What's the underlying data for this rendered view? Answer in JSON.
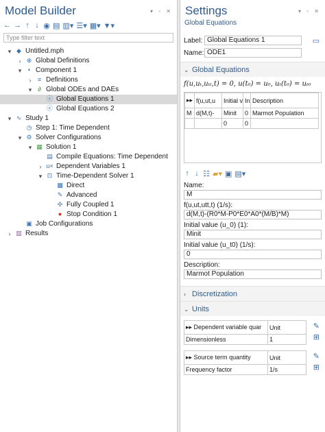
{
  "left": {
    "title": "Model Builder",
    "window_controls": "▾ ▫ ✕",
    "filter_placeholder": "Type filter text",
    "tree": [
      {
        "label": "Untitled.mph",
        "icon": "model-icon",
        "glyph": "◆",
        "color": "#3a74b8",
        "depth": 0,
        "arrow": "▾"
      },
      {
        "label": "Global Definitions",
        "icon": "globe-icon",
        "glyph": "⊕",
        "color": "#3a74b8",
        "depth": 1,
        "arrow": "›"
      },
      {
        "label": "Component 1",
        "icon": "component-icon",
        "glyph": "•",
        "color": "#3a74b8",
        "depth": 1,
        "arrow": "▾"
      },
      {
        "label": "Definitions",
        "icon": "definitions-icon",
        "glyph": "≡",
        "color": "#3a74b8",
        "depth": 2,
        "arrow": "›"
      },
      {
        "label": "Global ODEs and DAEs",
        "icon": "ode-icon",
        "glyph": "∂",
        "color": "#4a7a3a",
        "depth": 2,
        "arrow": "▾"
      },
      {
        "label": "Global Equations 1",
        "icon": "global-equations-icon",
        "glyph": "ⓔ",
        "color": "#3a74b8",
        "depth": 3,
        "arrow": "",
        "selected": true
      },
      {
        "label": "Global Equations 2",
        "icon": "global-equations-icon",
        "glyph": "ⓔ",
        "color": "#3a74b8",
        "depth": 3,
        "arrow": ""
      },
      {
        "label": "Study 1",
        "icon": "study-icon",
        "glyph": "∿",
        "color": "#3a74b8",
        "depth": 0,
        "arrow": "▾"
      },
      {
        "label": "Step 1: Time Dependent",
        "icon": "time-step-icon",
        "glyph": "◷",
        "color": "#3a74b8",
        "depth": 1,
        "arrow": ""
      },
      {
        "label": "Solver Configurations",
        "icon": "solver-configurations-icon",
        "glyph": "⚙",
        "color": "#3a74b8",
        "depth": 1,
        "arrow": "▾"
      },
      {
        "label": "Solution 1",
        "icon": "solution-icon",
        "glyph": "▦",
        "color": "#4a9a4a",
        "depth": 2,
        "arrow": "▾"
      },
      {
        "label": "Compile Equations: Time Dependent",
        "icon": "compile-icon",
        "glyph": "▤",
        "color": "#3a74b8",
        "depth": 3,
        "arrow": ""
      },
      {
        "label": "Dependent Variables 1",
        "icon": "variables-icon",
        "glyph": "u×",
        "color": "#3a74b8",
        "depth": 3,
        "arrow": "›"
      },
      {
        "label": "Time-Dependent Solver 1",
        "icon": "time-solver-icon",
        "glyph": "⊡",
        "color": "#3a74b8",
        "depth": 3,
        "arrow": "▾"
      },
      {
        "label": "Direct",
        "icon": "direct-icon",
        "glyph": "▩",
        "color": "#3a74b8",
        "depth": 4,
        "arrow": ""
      },
      {
        "label": "Advanced",
        "icon": "advanced-icon",
        "glyph": "✎",
        "color": "#3a74b8",
        "depth": 4,
        "arrow": ""
      },
      {
        "label": "Fully Coupled 1",
        "icon": "fully-coupled-icon",
        "glyph": "✣",
        "color": "#3a74b8",
        "depth": 4,
        "arrow": ""
      },
      {
        "label": "Stop Condition 1",
        "icon": "stop-icon",
        "glyph": "●",
        "color": "#d0312d",
        "depth": 4,
        "arrow": ""
      },
      {
        "label": "Job Configurations",
        "icon": "job-configurations-icon",
        "glyph": "▣",
        "color": "#3a74b8",
        "depth": 1,
        "arrow": ""
      },
      {
        "label": "Results",
        "icon": "results-icon",
        "glyph": "▥",
        "color": "#8a5a9a",
        "depth": 0,
        "arrow": "›"
      }
    ]
  },
  "right": {
    "title": "Settings",
    "window_controls": "▾ ▫ ✕",
    "subtitle": "Global Equations",
    "label_field": {
      "label": "Label:",
      "value": "Global Equations 1"
    },
    "name_field": {
      "label": "Name:",
      "value": "ODE1"
    },
    "section_global": "Global Equations",
    "equation": "f(u,uₜ,uₜₜ,t) = 0,  u(t₀) = u₀,  uₜ(t₀) = uₜ₀",
    "table": {
      "headers": [
        "▸▸",
        "f(u,ut,u",
        "Initial v",
        "In",
        "Description"
      ],
      "rows": [
        [
          "M",
          "d(M,t)-",
          "Minit",
          "0",
          "Marmot Population"
        ],
        [
          "",
          "",
          "0",
          "0",
          ""
        ]
      ]
    },
    "name_label": "Name:",
    "name_value": "M",
    "f_label": "f(u,ut,utt,t) (1/s):",
    "f_value": "d(M,t)-(R0*M-P0*E0*A0*(M/B)*M)",
    "init_label": "Initial value (u_0) (1):",
    "init_value": "Minit",
    "init_t_label": "Initial value (u_t0) (1/s):",
    "init_t_value": "0",
    "desc_label": "Description:",
    "desc_value": "Marmot Population",
    "section_disc": "Discretization",
    "section_units": "Units",
    "units_table1": {
      "headers": [
        "Dependent variable quar",
        "Unit"
      ],
      "row": [
        "Dimensionless",
        "1"
      ]
    },
    "units_table2": {
      "headers": [
        "Source term quantity",
        "Unit"
      ],
      "row": [
        "Frequency factor",
        "1/s"
      ]
    }
  }
}
